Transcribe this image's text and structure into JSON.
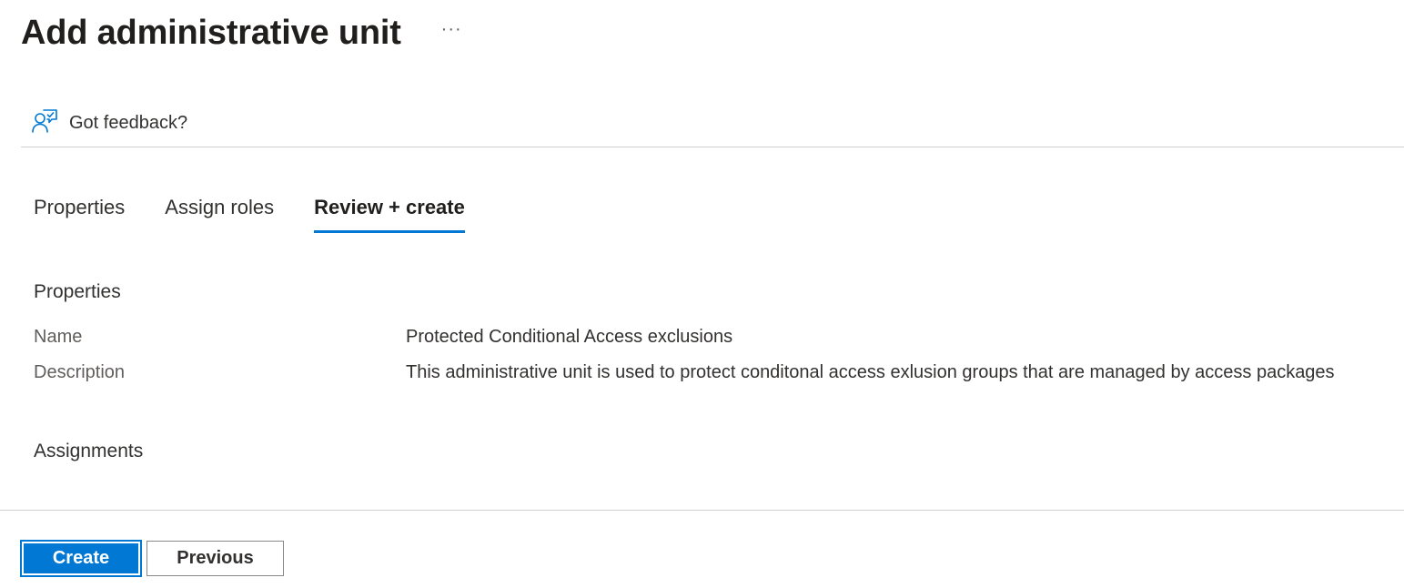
{
  "header": {
    "title": "Add administrative unit",
    "more_label": "···"
  },
  "feedback": {
    "icon": "feedback-person-icon",
    "label": "Got feedback?"
  },
  "tabs": [
    {
      "label": "Properties",
      "active": false
    },
    {
      "label": "Assign roles",
      "active": false
    },
    {
      "label": "Review + create",
      "active": true
    }
  ],
  "review": {
    "properties_heading": "Properties",
    "fields": [
      {
        "label": "Name",
        "value": "Protected Conditional Access exclusions"
      },
      {
        "label": "Description",
        "value": "This administrative unit is used to protect conditonal access exlusion groups that are managed by access packages"
      }
    ],
    "assignments_heading": "Assignments"
  },
  "footer": {
    "create_label": "Create",
    "previous_label": "Previous"
  },
  "colors": {
    "accent": "#0078d4",
    "text": "#323130",
    "label_gray": "#605e5c",
    "divider": "#d2d0ce"
  }
}
